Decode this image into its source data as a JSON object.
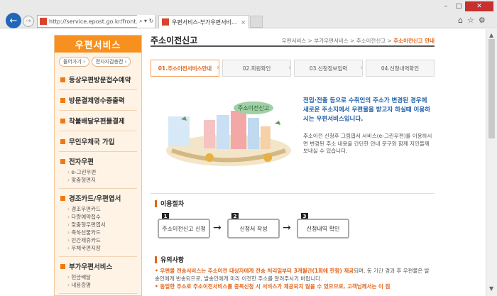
{
  "browser": {
    "url": "http://service.epost.go.kr/front.Retriev",
    "tab_title": "우편서비스-부가우편서비...",
    "tab_close": "×",
    "address_controls": "⌕ ▾ ↻",
    "toolbar_icons": [
      "⌂",
      "☆",
      "⚙"
    ],
    "window_controls": {
      "minimize": "–",
      "maximize": "□",
      "close": "✕"
    },
    "back_glyph": "←",
    "forward_glyph": "→",
    "scroll_up": "▲",
    "scroll_down": "▼"
  },
  "sidebar": {
    "title": "우편서비스",
    "buttons": [
      "들어가기 ›",
      "전자지갑충전 ›"
    ],
    "items": [
      "등상우편방문접수예약",
      "방문결제영수증출력",
      "착불배달우편물결제",
      "무인우체국 가입"
    ],
    "groups": [
      {
        "title": "전자우편",
        "subs": [
          "e-그린우편",
          "맞춤형편지"
        ]
      },
      {
        "title": "경조카드/우편엽서",
        "subs": [
          "경조우편카드",
          "다량예약접수",
          "맞춤형우편엽서",
          "축하선물카드",
          "민간제휴카드",
          "우체국편지장"
        ]
      },
      {
        "title": "부가우편서비스",
        "subs": [
          "현금배달",
          "내용증명"
        ]
      }
    ]
  },
  "main": {
    "title": "주소이전신고",
    "breadcrumb": [
      "우편서비스",
      "부가우편서비스",
      "주소이전신고"
    ],
    "breadcrumb_sep": " > ",
    "breadcrumb_current": "주소이전신고 안내",
    "steps": [
      "01.주소이전서비스안내",
      "02.회원확인",
      "03.신청정보입력",
      "04.신청내역확인"
    ],
    "illustration_sign": "주소이전신고",
    "intro_highlight": "전입·전출 등으로 수취인의 주소가 변경된 경우에 새로운 주소지에서 우편물을 받고자 하실때 이용하시는 우편서비스입니다.",
    "intro_text": "주소이전 신청후 그림엽서 서비스(e-그린우편)를 이용하시면 변경된 주소 내용을 간단한 안내 문구와 함께 지인들께 보내실 수 있습니다.",
    "procedure_title": "이용절차",
    "procedure": [
      {
        "num": "1",
        "label": "주소이전신고 신청"
      },
      {
        "num": "2",
        "label": "신청서 작성"
      },
      {
        "num": "3",
        "label": "신청내역 확인"
      }
    ],
    "procedure_arrow": "→",
    "notes_title": "유의사항",
    "notes": [
      {
        "bullet": "• ",
        "highlight": "우편물 전송서비스는 주소이전 대상자에게 전송 처리일부터 3개월간(1회에 한함) 제공",
        "rest": "되며, 동 기간 경과 후 우편물은 발송인에게 반송되므로, 발송인에게 미리 이전한 주소를 알려주시기 바랍니다."
      },
      {
        "bullet": "• ",
        "highlight": "동일한 주소로 주소이전서비스를 중복신청 시 서비스가 제공되지 않을 수 있으므로, 고객님께서는 이 점",
        "rest": ""
      }
    ]
  },
  "colors": {
    "accent": "#f7901e",
    "highlight": "#e0641a",
    "link": "#1d5ea8"
  }
}
